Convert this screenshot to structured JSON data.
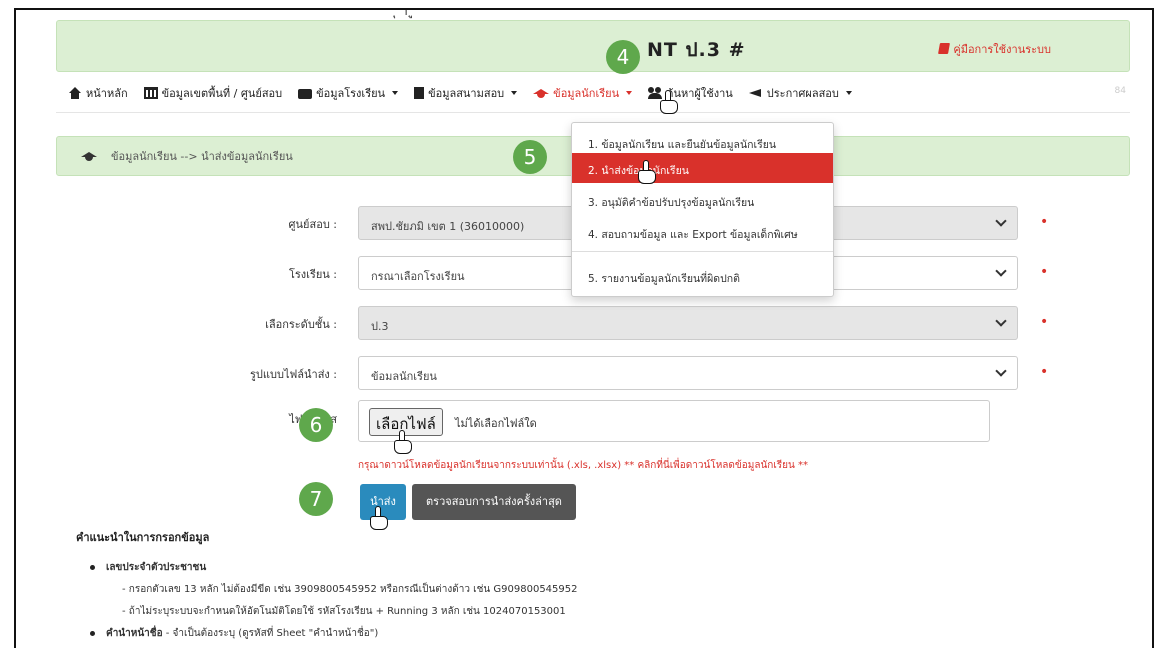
{
  "top_clip": "ุ     ำ                                                                          ู",
  "header": {
    "title": "NT ป.3 #",
    "manual_link": "คู่มือการใช้งานระบบ"
  },
  "nav": {
    "items": [
      {
        "label": "หน้าหลัก",
        "icon": "home-icon"
      },
      {
        "label": "ข้อมูลเขตพื้นที่ / ศูนย์สอบ",
        "icon": "bank-icon"
      },
      {
        "label": "ข้อมูลโรงเรียน",
        "icon": "briefcase-icon"
      },
      {
        "label": "ข้อมูลสนามสอบ",
        "icon": "building-icon"
      },
      {
        "label": "ข้อมูลนักเรียน",
        "icon": "graduation-cap-icon"
      },
      {
        "label": "ค้นหาผู้ใช้งาน",
        "icon": "users-icon"
      },
      {
        "label": "ประกาศผลสอบ",
        "icon": "megaphone-icon"
      }
    ],
    "faint": "84"
  },
  "breadcrumb": "ข้อมูลนักเรียน --> นำส่งข้อมูลนักเรียน",
  "form": {
    "center_label": "ศูนย์สอบ :",
    "center_value": "สพป.ชัยภมิ เขต 1 (36010000)",
    "school_label": "โรงเรียน :",
    "school_value": "กรณาเลือกโรงเรียน",
    "grade_label": "เลือกระดับชั้น :",
    "grade_value": "ป.3",
    "format_label": "รูปแบบไฟล์นำส่ง :",
    "format_value": "ข้อมลนักเรียน",
    "file_label": "ไฟล์ที่นำส",
    "file_button": "เลือกไฟล์",
    "file_status": "ไม่ได้เลือกไฟล์ใด",
    "required_mark": "•",
    "hint": "กรุณาดาวน์โหลดข้อมูลนักเรียนจากระบบเท่านั้น (.xls, .xlsx)   ** คลิกที่นี่เพื่อดาวน์โหลดข้อมูลนักเรียน **",
    "upload_button": "นำส่ง",
    "check_button": "ตรวจสอบการนำส่งครั้งล่าสุด"
  },
  "guide": {
    "title": "คำแนะนำในการกรอกข้อมูล",
    "id_title": "เลขประจำตัวประชาชน",
    "id_line1": "- กรอกตัวเลข 13 หลัก ไม่ต้องมีขีด เช่น 3909800545952 หรือกรณีเป็นต่างด้าว เช่น G909800545952",
    "id_line2": "- ถ้าไม่ระบุระบบจะกำหนดให้อัตโนมัติโดยใช้ รหัสโรงเรียน + Running 3 หลัก เช่น 1024070153001",
    "prefix_title": "คำนำหน้าชื่อ",
    "prefix_text": " - จำเป็นต้องระบุ (ดูรหัสที่ Sheet \"คำนำหน้าชื่อ\")"
  },
  "dropdown": {
    "items": [
      "1. ข้อมูลนักเรียน และยืนยันข้อมูลนักเรียน",
      "2. นำส่งข้อมูลนักเรียน",
      "3. อนุมัติคำข้อปรับปรุงข้อมูลนักเรียน",
      "4. สอบถามข้อมูล และ Export ข้อมูลเด็กพิเศษ",
      "5. รายงานข้อมูลนักเรียนที่ผิดปกติ"
    ]
  },
  "steps": [
    "4",
    "5",
    "6",
    "7"
  ],
  "colors": {
    "accent_red": "#d9312b",
    "header_green": "#dcefd3",
    "step_green": "#5fa84c",
    "upload_blue": "#2a8bbd",
    "check_grey": "#555555"
  }
}
